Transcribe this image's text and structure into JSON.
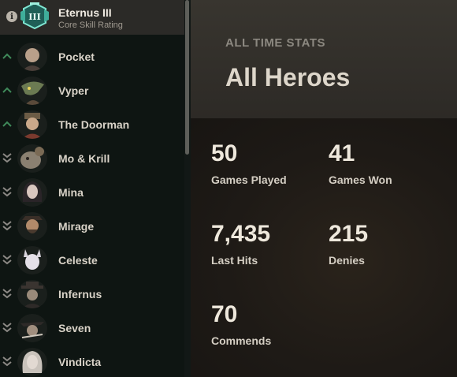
{
  "rank": {
    "info_icon": "info-icon",
    "emblem_text": "III",
    "name": "Eternus III",
    "subtitle": "Core Skill Rating",
    "emblem_color": "#4fd1b8"
  },
  "heroes": [
    {
      "name": "Pocket",
      "trend": "up"
    },
    {
      "name": "Vyper",
      "trend": "up"
    },
    {
      "name": "The Doorman",
      "trend": "up"
    },
    {
      "name": "Mo & Krill",
      "trend": "down"
    },
    {
      "name": "Mina",
      "trend": "down"
    },
    {
      "name": "Mirage",
      "trend": "down"
    },
    {
      "name": "Celeste",
      "trend": "down"
    },
    {
      "name": "Infernus",
      "trend": "down"
    },
    {
      "name": "Seven",
      "trend": "down"
    },
    {
      "name": "Vindicta",
      "trend": "down"
    }
  ],
  "main": {
    "kicker": "ALL TIME STATS",
    "title": "All Heroes",
    "stats": {
      "games_played": {
        "value": "50",
        "label": "Games Played"
      },
      "games_won": {
        "value": "41",
        "label": "Games Won"
      },
      "last_hits": {
        "value": "7,435",
        "label": "Last Hits"
      },
      "denies": {
        "value": "215",
        "label": "Denies"
      },
      "commends": {
        "value": "70",
        "label": "Commends"
      }
    }
  },
  "colors": {
    "trend_up": "#3f8a5a",
    "trend_down": "#8d8a86",
    "sidebar_bg": "#0e1512",
    "header_bg": "#38352f"
  }
}
